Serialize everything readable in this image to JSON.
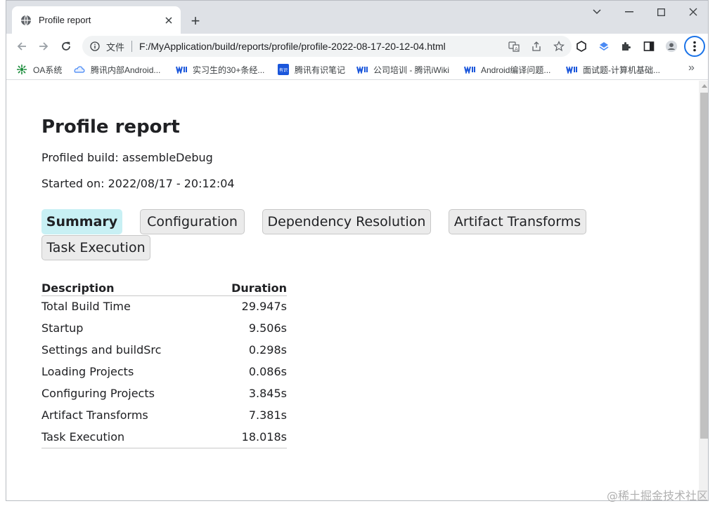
{
  "browser": {
    "tab_title": "Profile report",
    "tab_favicon": "globe-icon",
    "new_tab": "+",
    "omnibox": {
      "security_label": "文件",
      "url": "F:/MyApplication/build/reports/profile/profile-2022-08-17-20-12-04.html"
    },
    "bookmarks": [
      {
        "label": "OA系统",
        "icon": "oa-icon"
      },
      {
        "label": "腾讯内部Android...",
        "icon": "cloud-icon"
      },
      {
        "label": "实习生的30+条经...",
        "icon": "iwiki-icon"
      },
      {
        "label": "腾讯有识笔记",
        "icon": "notes-icon"
      },
      {
        "label": "公司培训 - 腾讯iWiki",
        "icon": "iwiki-icon"
      },
      {
        "label": "Android编译问题...",
        "icon": "iwiki-icon"
      },
      {
        "label": "面试题-计算机基础...",
        "icon": "iwiki-icon"
      }
    ],
    "bookmarks_more": "»"
  },
  "report": {
    "title": "Profile report",
    "profiled_build": "Profiled build: assembleDebug",
    "started_on": "Started on: 2022/08/17 - 20:12:04",
    "tabs": [
      "Summary",
      "Configuration",
      "Dependency Resolution",
      "Artifact Transforms",
      "Task Execution"
    ],
    "active_tab": "Summary",
    "table": {
      "headers": [
        "Description",
        "Duration"
      ],
      "rows": [
        [
          "Total Build Time",
          "29.947s"
        ],
        [
          "Startup",
          "9.506s"
        ],
        [
          "Settings and buildSrc",
          "0.298s"
        ],
        [
          "Loading Projects",
          "0.086s"
        ],
        [
          "Configuring Projects",
          "3.845s"
        ],
        [
          "Artifact Transforms",
          "7.381s"
        ],
        [
          "Task Execution",
          "18.018s"
        ]
      ]
    }
  },
  "watermark": "@稀土掘金技术社区",
  "colors": {
    "active_tab": "#c8f0f4",
    "inactive_tab": "#ebebeb",
    "tabstrip": "#dee1e6",
    "accent": "#1a73e8"
  }
}
